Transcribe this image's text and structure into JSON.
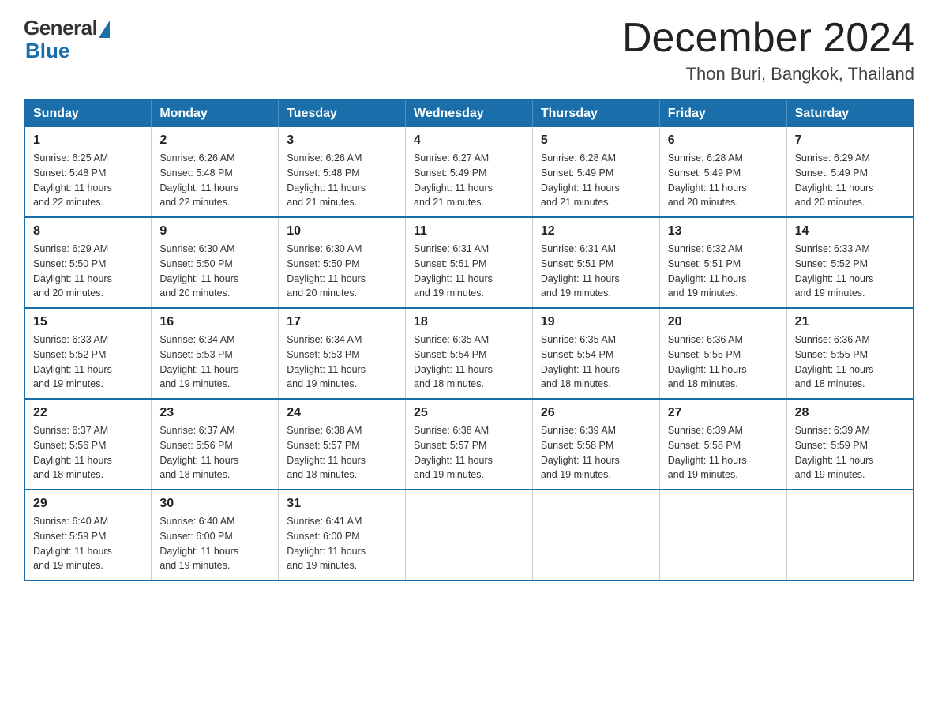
{
  "header": {
    "logo_general": "General",
    "logo_blue": "Blue",
    "month_title": "December 2024",
    "subtitle": "Thon Buri, Bangkok, Thailand"
  },
  "weekdays": [
    "Sunday",
    "Monday",
    "Tuesday",
    "Wednesday",
    "Thursday",
    "Friday",
    "Saturday"
  ],
  "weeks": [
    [
      {
        "day": "1",
        "sunrise": "6:25 AM",
        "sunset": "5:48 PM",
        "daylight": "11 hours and 22 minutes."
      },
      {
        "day": "2",
        "sunrise": "6:26 AM",
        "sunset": "5:48 PM",
        "daylight": "11 hours and 22 minutes."
      },
      {
        "day": "3",
        "sunrise": "6:26 AM",
        "sunset": "5:48 PM",
        "daylight": "11 hours and 21 minutes."
      },
      {
        "day": "4",
        "sunrise": "6:27 AM",
        "sunset": "5:49 PM",
        "daylight": "11 hours and 21 minutes."
      },
      {
        "day": "5",
        "sunrise": "6:28 AM",
        "sunset": "5:49 PM",
        "daylight": "11 hours and 21 minutes."
      },
      {
        "day": "6",
        "sunrise": "6:28 AM",
        "sunset": "5:49 PM",
        "daylight": "11 hours and 20 minutes."
      },
      {
        "day": "7",
        "sunrise": "6:29 AM",
        "sunset": "5:49 PM",
        "daylight": "11 hours and 20 minutes."
      }
    ],
    [
      {
        "day": "8",
        "sunrise": "6:29 AM",
        "sunset": "5:50 PM",
        "daylight": "11 hours and 20 minutes."
      },
      {
        "day": "9",
        "sunrise": "6:30 AM",
        "sunset": "5:50 PM",
        "daylight": "11 hours and 20 minutes."
      },
      {
        "day": "10",
        "sunrise": "6:30 AM",
        "sunset": "5:50 PM",
        "daylight": "11 hours and 20 minutes."
      },
      {
        "day": "11",
        "sunrise": "6:31 AM",
        "sunset": "5:51 PM",
        "daylight": "11 hours and 19 minutes."
      },
      {
        "day": "12",
        "sunrise": "6:31 AM",
        "sunset": "5:51 PM",
        "daylight": "11 hours and 19 minutes."
      },
      {
        "day": "13",
        "sunrise": "6:32 AM",
        "sunset": "5:51 PM",
        "daylight": "11 hours and 19 minutes."
      },
      {
        "day": "14",
        "sunrise": "6:33 AM",
        "sunset": "5:52 PM",
        "daylight": "11 hours and 19 minutes."
      }
    ],
    [
      {
        "day": "15",
        "sunrise": "6:33 AM",
        "sunset": "5:52 PM",
        "daylight": "11 hours and 19 minutes."
      },
      {
        "day": "16",
        "sunrise": "6:34 AM",
        "sunset": "5:53 PM",
        "daylight": "11 hours and 19 minutes."
      },
      {
        "day": "17",
        "sunrise": "6:34 AM",
        "sunset": "5:53 PM",
        "daylight": "11 hours and 19 minutes."
      },
      {
        "day": "18",
        "sunrise": "6:35 AM",
        "sunset": "5:54 PM",
        "daylight": "11 hours and 18 minutes."
      },
      {
        "day": "19",
        "sunrise": "6:35 AM",
        "sunset": "5:54 PM",
        "daylight": "11 hours and 18 minutes."
      },
      {
        "day": "20",
        "sunrise": "6:36 AM",
        "sunset": "5:55 PM",
        "daylight": "11 hours and 18 minutes."
      },
      {
        "day": "21",
        "sunrise": "6:36 AM",
        "sunset": "5:55 PM",
        "daylight": "11 hours and 18 minutes."
      }
    ],
    [
      {
        "day": "22",
        "sunrise": "6:37 AM",
        "sunset": "5:56 PM",
        "daylight": "11 hours and 18 minutes."
      },
      {
        "day": "23",
        "sunrise": "6:37 AM",
        "sunset": "5:56 PM",
        "daylight": "11 hours and 18 minutes."
      },
      {
        "day": "24",
        "sunrise": "6:38 AM",
        "sunset": "5:57 PM",
        "daylight": "11 hours and 18 minutes."
      },
      {
        "day": "25",
        "sunrise": "6:38 AM",
        "sunset": "5:57 PM",
        "daylight": "11 hours and 19 minutes."
      },
      {
        "day": "26",
        "sunrise": "6:39 AM",
        "sunset": "5:58 PM",
        "daylight": "11 hours and 19 minutes."
      },
      {
        "day": "27",
        "sunrise": "6:39 AM",
        "sunset": "5:58 PM",
        "daylight": "11 hours and 19 minutes."
      },
      {
        "day": "28",
        "sunrise": "6:39 AM",
        "sunset": "5:59 PM",
        "daylight": "11 hours and 19 minutes."
      }
    ],
    [
      {
        "day": "29",
        "sunrise": "6:40 AM",
        "sunset": "5:59 PM",
        "daylight": "11 hours and 19 minutes."
      },
      {
        "day": "30",
        "sunrise": "6:40 AM",
        "sunset": "6:00 PM",
        "daylight": "11 hours and 19 minutes."
      },
      {
        "day": "31",
        "sunrise": "6:41 AM",
        "sunset": "6:00 PM",
        "daylight": "11 hours and 19 minutes."
      },
      null,
      null,
      null,
      null
    ]
  ],
  "labels": {
    "sunrise": "Sunrise:",
    "sunset": "Sunset:",
    "daylight": "Daylight:"
  }
}
